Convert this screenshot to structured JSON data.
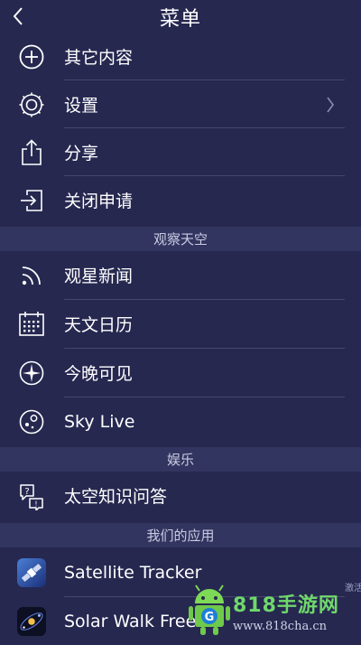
{
  "header": {
    "title": "菜单",
    "back_icon": "chevron-left-icon"
  },
  "menu": [
    {
      "label": "其它内容",
      "icon": "plus-circle-icon"
    },
    {
      "label": "设置",
      "icon": "gear-icon",
      "has_chevron": true
    },
    {
      "label": "分享",
      "icon": "share-icon"
    },
    {
      "label": "关闭申请",
      "icon": "sign-in-icon"
    }
  ],
  "sections": {
    "observe": "观察天空",
    "entertainment": "娱乐",
    "apps": "我们的应用"
  },
  "observe_items": [
    {
      "label": "观星新闻",
      "icon": "rss-icon"
    },
    {
      "label": "天文日历",
      "icon": "calendar-icon"
    },
    {
      "label": "今晚可见",
      "icon": "compass-star-icon"
    },
    {
      "label": "Sky Live",
      "icon": "planet-moons-icon"
    }
  ],
  "entertainment_items": [
    {
      "label": "太空知识问答",
      "icon": "quiz-bubble-icon"
    }
  ],
  "app_items": [
    {
      "label": "Satellite Tracker",
      "icon": "satellite-app-icon"
    },
    {
      "label": "Solar Walk Free",
      "icon": "solar-walk-app-icon"
    }
  ],
  "watermark": {
    "text": "818手游网",
    "url": "www.818cha.cn",
    "side_text": "激活"
  },
  "colors": {
    "background": "#262850",
    "section_bg": "#32355f",
    "divider": "#45476e",
    "watermark_green": "#6fd86a"
  }
}
